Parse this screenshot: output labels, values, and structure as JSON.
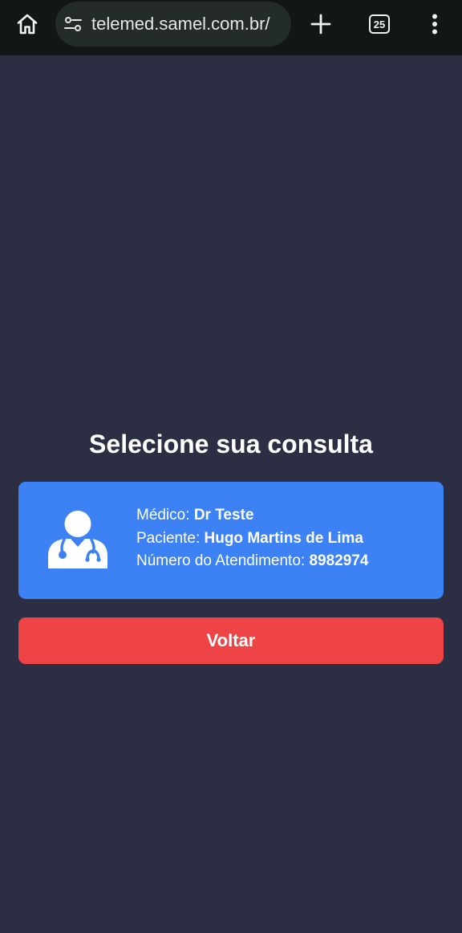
{
  "browser": {
    "url": "telemed.samel.com.br/",
    "tab_count": "25",
    "icons": {
      "home": "home-icon",
      "site_settings": "tune-icon",
      "new_tab": "plus-icon",
      "tabs": "tab-switcher-icon",
      "menu": "more-vert-icon"
    }
  },
  "page": {
    "title": "Selecione sua consulta"
  },
  "consultation": {
    "icon": "doctor-icon",
    "doctor_label": "Médico:",
    "doctor_value": "Dr Teste",
    "patient_label": "Paciente:",
    "patient_value": "Hugo Martins de Lima",
    "number_label": "Número do Atendimento:",
    "number_value": "8982974"
  },
  "actions": {
    "back_label": "Voltar"
  },
  "colors": {
    "background": "#2c2e43",
    "browser_bar": "#121616",
    "card": "#3c82f4",
    "back_button": "#ef4446",
    "text": "#ffffff"
  }
}
